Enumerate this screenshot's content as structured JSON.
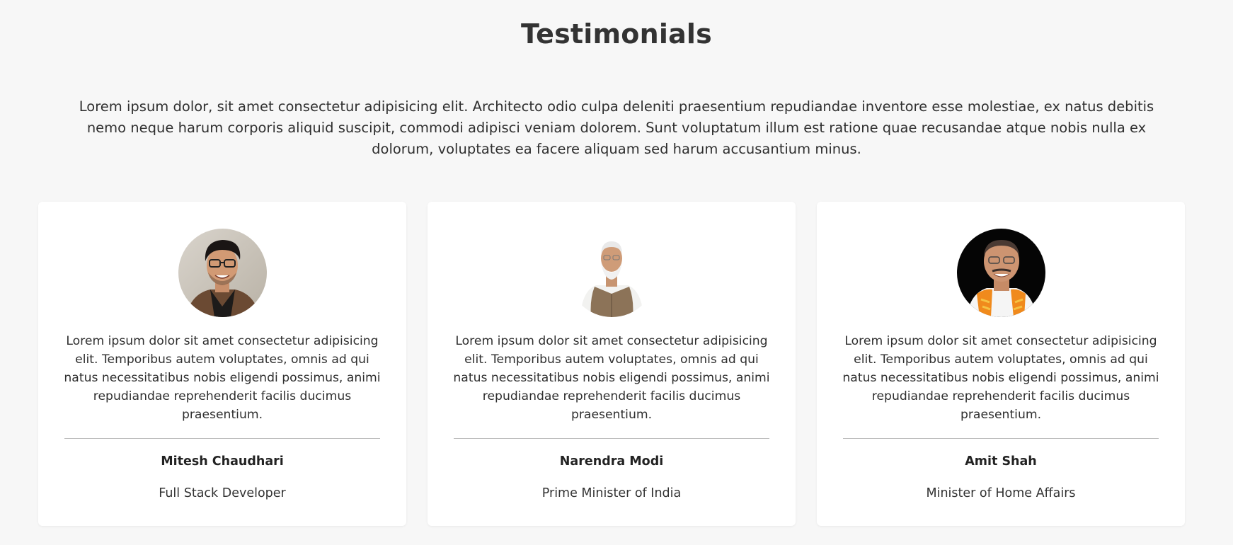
{
  "section": {
    "title": "Testimonials",
    "intro": "Lorem ipsum dolor, sit amet consectetur adipisicing elit. Architecto odio culpa deleniti praesentium repudiandae inventore esse molestiae, ex natus debitis nemo neque harum corporis aliquid suscipit, commodi adipisci veniam dolorem. Sunt voluptatum illum est ratione quae recusandae atque nobis nulla ex dolorum, voluptates ea facere aliquam sed harum accusantium minus."
  },
  "testimonials": [
    {
      "quote": "Lorem ipsum dolor sit amet consectetur adipisicing elit. Temporibus autem voluptates, omnis ad qui natus necessitatibus nobis eligendi possimus, animi repudiandae reprehenderit facilis ducimus praesentium.",
      "name": "Mitesh Chaudhari",
      "role": "Full Stack Developer"
    },
    {
      "quote": "Lorem ipsum dolor sit amet consectetur adipisicing elit. Temporibus autem voluptates, omnis ad qui natus necessitatibus nobis eligendi possimus, animi repudiandae reprehenderit facilis ducimus praesentium.",
      "name": "Narendra Modi",
      "role": "Prime Minister of India"
    },
    {
      "quote": "Lorem ipsum dolor sit amet consectetur adipisicing elit. Temporibus autem voluptates, omnis ad qui natus necessitatibus nobis eligendi possimus, animi repudiandae reprehenderit facilis ducimus praesentium.",
      "name": "Amit Shah",
      "role": "Minister of Home Affairs"
    }
  ],
  "colors": {
    "page_background": "#f7f7f7",
    "card_background": "#ffffff",
    "divider": "#bdbdbd",
    "text": "#2f2f2f"
  }
}
